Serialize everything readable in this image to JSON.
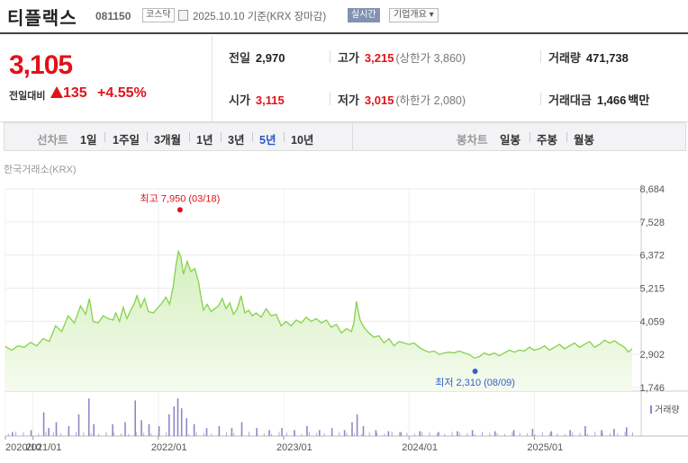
{
  "header": {
    "stock_name": "티플랙스",
    "stock_code": "081150",
    "market": "코스닥",
    "date_text": "2025.10.10  기준(KRX 장마감)",
    "realtime_label": "실시간",
    "company_info_label": "기업개요 ▾"
  },
  "summary": {
    "price": "3,105",
    "change_label": "전일대비",
    "change_value": "135",
    "change_pct": "+4.55%",
    "prev_close_label": "전일",
    "prev_close": "2,970",
    "high_label": "고가",
    "high": "3,215",
    "upper_limit": "(상한가 3,860)",
    "volume_label": "거래량",
    "volume": "471,738",
    "open_label": "시가",
    "open": "3,115",
    "low_label": "저가",
    "low": "3,015",
    "lower_limit": "(하한가 2,080)",
    "amount_label": "거래대금",
    "amount": "1,466",
    "amount_unit": "백만"
  },
  "periods": {
    "line_label": "선차트",
    "line_options": [
      "1일",
      "1주일",
      "3개월",
      "1년",
      "3년",
      "5년",
      "10년"
    ],
    "active": "5년",
    "candle_label": "봉차트",
    "candle_options": [
      "일봉",
      "주봉",
      "월봉"
    ]
  },
  "exchange_label": "한국거래소(KRX)",
  "colors": {
    "up": "#e0121b",
    "down": "#3562c8",
    "line": "#86d24a",
    "area_top": "#d4efbd",
    "area_bottom": "#f3fbea",
    "volume": "#8b88c8"
  },
  "chart_data": {
    "type": "area",
    "y_ticks": [
      "8,684",
      "7,528",
      "6,372",
      "5,215",
      "4,059",
      "2,902",
      "1,746"
    ],
    "ylim": [
      1746,
      8684
    ],
    "x_ticks": [
      {
        "t": 0.0,
        "label": "2020/10"
      },
      {
        "t": 0.22,
        "label": "2021/01"
      },
      {
        "t": 1.22,
        "label": "2022/01"
      },
      {
        "t": 2.22,
        "label": "2023/01"
      },
      {
        "t": 3.22,
        "label": "2024/01"
      },
      {
        "t": 4.22,
        "label": "2025/01"
      }
    ],
    "t_range": [
      0,
      5.0
    ],
    "series": [
      {
        "values": [
          [
            0.0,
            3180
          ],
          [
            0.05,
            3050
          ],
          [
            0.1,
            3200
          ],
          [
            0.15,
            3150
          ],
          [
            0.2,
            3320
          ],
          [
            0.25,
            3200
          ],
          [
            0.3,
            3450
          ],
          [
            0.35,
            3350
          ],
          [
            0.4,
            3900
          ],
          [
            0.45,
            3700
          ],
          [
            0.5,
            4250
          ],
          [
            0.55,
            4000
          ],
          [
            0.6,
            4600
          ],
          [
            0.64,
            4300
          ],
          [
            0.67,
            4850
          ],
          [
            0.7,
            4050
          ],
          [
            0.74,
            4000
          ],
          [
            0.78,
            4250
          ],
          [
            0.82,
            4150
          ],
          [
            0.86,
            4100
          ],
          [
            0.88,
            4350
          ],
          [
            0.91,
            4050
          ],
          [
            0.94,
            4550
          ],
          [
            0.97,
            4150
          ],
          [
            1.0,
            4450
          ],
          [
            1.03,
            4700
          ],
          [
            1.05,
            4950
          ],
          [
            1.08,
            4550
          ],
          [
            1.11,
            4850
          ],
          [
            1.14,
            4400
          ],
          [
            1.18,
            4350
          ],
          [
            1.22,
            4550
          ],
          [
            1.25,
            4700
          ],
          [
            1.28,
            4900
          ],
          [
            1.31,
            4650
          ],
          [
            1.34,
            5300
          ],
          [
            1.36,
            6000
          ],
          [
            1.38,
            6500
          ],
          [
            1.4,
            6300
          ],
          [
            1.42,
            5700
          ],
          [
            1.45,
            6150
          ],
          [
            1.48,
            5800
          ],
          [
            1.51,
            5900
          ],
          [
            1.54,
            5450
          ],
          [
            1.56,
            4900
          ],
          [
            1.58,
            4450
          ],
          [
            1.61,
            4650
          ],
          [
            1.64,
            4400
          ],
          [
            1.67,
            4500
          ],
          [
            1.7,
            4600
          ],
          [
            1.73,
            4850
          ],
          [
            1.76,
            4500
          ],
          [
            1.79,
            4700
          ],
          [
            1.82,
            4300
          ],
          [
            1.85,
            4500
          ],
          [
            1.88,
            4950
          ],
          [
            1.91,
            4350
          ],
          [
            1.94,
            4450
          ],
          [
            1.97,
            4250
          ],
          [
            2.0,
            4350
          ],
          [
            2.04,
            4200
          ],
          [
            2.08,
            4500
          ],
          [
            2.12,
            4250
          ],
          [
            2.16,
            4300
          ],
          [
            2.2,
            3900
          ],
          [
            2.24,
            4050
          ],
          [
            2.28,
            3900
          ],
          [
            2.32,
            4100
          ],
          [
            2.36,
            4000
          ],
          [
            2.4,
            4200
          ],
          [
            2.44,
            4050
          ],
          [
            2.48,
            4150
          ],
          [
            2.52,
            4000
          ],
          [
            2.56,
            4100
          ],
          [
            2.6,
            3850
          ],
          [
            2.64,
            3950
          ],
          [
            2.68,
            3650
          ],
          [
            2.72,
            3800
          ],
          [
            2.76,
            3700
          ],
          [
            2.78,
            4000
          ],
          [
            2.8,
            4750
          ],
          [
            2.83,
            4100
          ],
          [
            2.86,
            3850
          ],
          [
            2.9,
            3650
          ],
          [
            2.94,
            3500
          ],
          [
            2.98,
            3550
          ],
          [
            3.02,
            3300
          ],
          [
            3.06,
            3450
          ],
          [
            3.1,
            3200
          ],
          [
            3.14,
            3350
          ],
          [
            3.18,
            3300
          ],
          [
            3.22,
            3250
          ],
          [
            3.26,
            3300
          ],
          [
            3.3,
            3150
          ],
          [
            3.34,
            3050
          ],
          [
            3.38,
            2980
          ],
          [
            3.42,
            3020
          ],
          [
            3.46,
            2900
          ],
          [
            3.5,
            2950
          ],
          [
            3.54,
            2980
          ],
          [
            3.58,
            2950
          ],
          [
            3.62,
            3020
          ],
          [
            3.66,
            2950
          ],
          [
            3.7,
            2900
          ],
          [
            3.74,
            2780
          ],
          [
            3.78,
            2820
          ],
          [
            3.82,
            2950
          ],
          [
            3.86,
            2880
          ],
          [
            3.9,
            2950
          ],
          [
            3.94,
            2850
          ],
          [
            3.98,
            2950
          ],
          [
            4.02,
            3050
          ],
          [
            4.06,
            2980
          ],
          [
            4.1,
            3050
          ],
          [
            4.14,
            3020
          ],
          [
            4.18,
            3150
          ],
          [
            4.22,
            3050
          ],
          [
            4.26,
            3100
          ],
          [
            4.3,
            3200
          ],
          [
            4.34,
            3050
          ],
          [
            4.38,
            3150
          ],
          [
            4.42,
            3250
          ],
          [
            4.46,
            3100
          ],
          [
            4.5,
            3200
          ],
          [
            4.54,
            3300
          ],
          [
            4.58,
            3150
          ],
          [
            4.62,
            3250
          ],
          [
            4.66,
            3350
          ],
          [
            4.7,
            3150
          ],
          [
            4.74,
            3250
          ],
          [
            4.78,
            3400
          ],
          [
            4.82,
            3300
          ],
          [
            4.86,
            3380
          ],
          [
            4.9,
            3250
          ],
          [
            4.94,
            3150
          ],
          [
            4.97,
            2980
          ],
          [
            5.0,
            3105
          ]
        ]
      }
    ],
    "high_annotation": {
      "label": "최고 7,950 (03/18)",
      "t": 1.4,
      "value": 7950
    },
    "low_annotation": {
      "label": "최저 2,310 (08/09)",
      "t": 3.74,
      "value": 2310
    },
    "volume_label": "거래량",
    "volume": [
      [
        0.05,
        0.1
      ],
      [
        0.2,
        0.15
      ],
      [
        0.3,
        0.6
      ],
      [
        0.34,
        0.2
      ],
      [
        0.4,
        0.35
      ],
      [
        0.5,
        0.25
      ],
      [
        0.58,
        0.55
      ],
      [
        0.66,
        0.95
      ],
      [
        0.7,
        0.3
      ],
      [
        0.85,
        0.3
      ],
      [
        0.95,
        0.35
      ],
      [
        1.03,
        0.9
      ],
      [
        1.08,
        0.4
      ],
      [
        1.14,
        0.3
      ],
      [
        1.22,
        0.25
      ],
      [
        1.3,
        0.55
      ],
      [
        1.34,
        0.75
      ],
      [
        1.37,
        0.95
      ],
      [
        1.4,
        0.7
      ],
      [
        1.44,
        0.45
      ],
      [
        1.5,
        0.3
      ],
      [
        1.6,
        0.2
      ],
      [
        1.7,
        0.25
      ],
      [
        1.8,
        0.2
      ],
      [
        1.88,
        0.35
      ],
      [
        2.0,
        0.2
      ],
      [
        2.1,
        0.15
      ],
      [
        2.2,
        0.2
      ],
      [
        2.3,
        0.15
      ],
      [
        2.4,
        0.25
      ],
      [
        2.5,
        0.15
      ],
      [
        2.6,
        0.2
      ],
      [
        2.7,
        0.15
      ],
      [
        2.76,
        0.35
      ],
      [
        2.8,
        0.55
      ],
      [
        2.85,
        0.25
      ],
      [
        2.95,
        0.15
      ],
      [
        3.05,
        0.12
      ],
      [
        3.15,
        0.1
      ],
      [
        3.3,
        0.12
      ],
      [
        3.45,
        0.1
      ],
      [
        3.6,
        0.12
      ],
      [
        3.72,
        0.15
      ],
      [
        3.9,
        0.12
      ],
      [
        4.05,
        0.15
      ],
      [
        4.2,
        0.18
      ],
      [
        4.35,
        0.12
      ],
      [
        4.5,
        0.15
      ],
      [
        4.62,
        0.25
      ],
      [
        4.75,
        0.15
      ],
      [
        4.85,
        0.18
      ],
      [
        4.95,
        0.22
      ]
    ]
  }
}
